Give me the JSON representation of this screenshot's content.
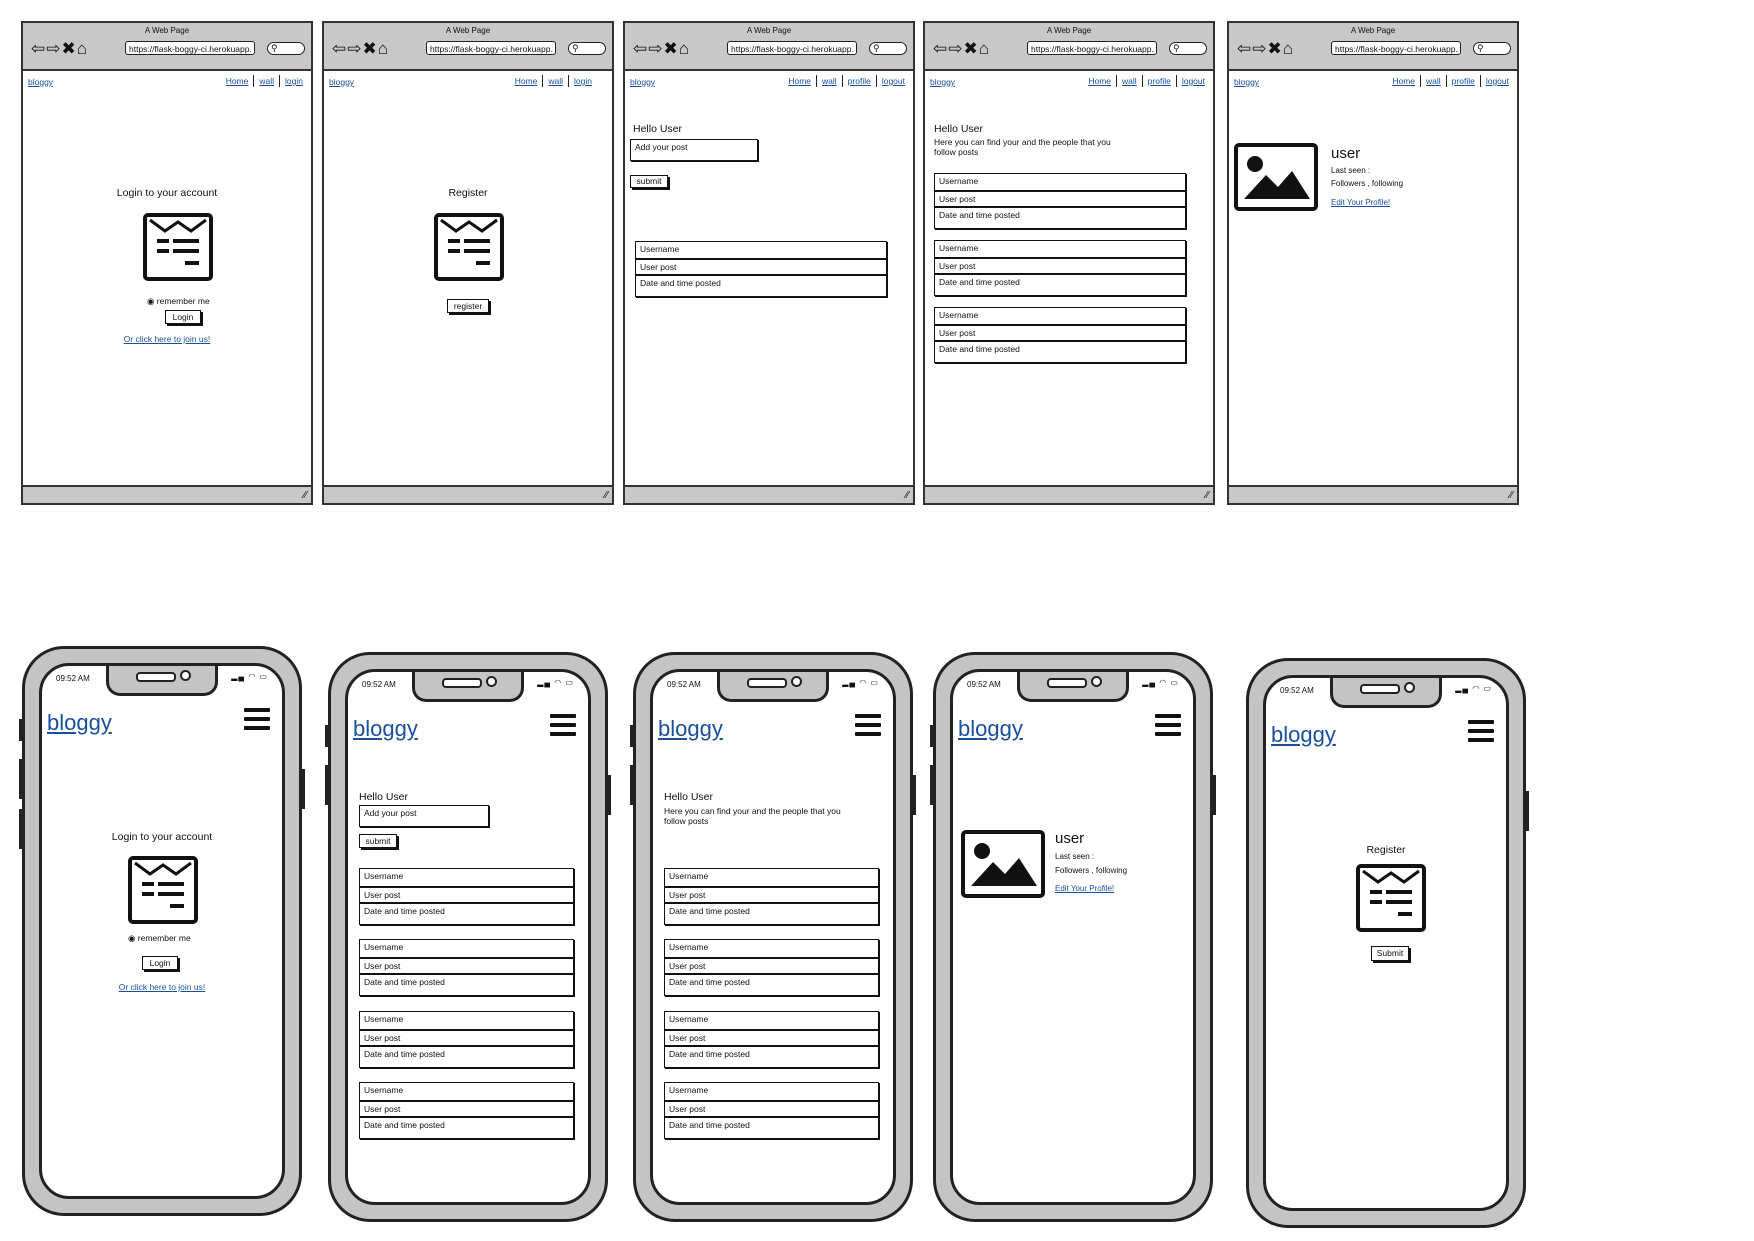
{
  "browser": {
    "window_title": "A Web Page",
    "url": "https://flask-boggy-ci.herokuapp.",
    "brand": "bloggy",
    "nav_home": "Home",
    "nav_wall": "wall",
    "nav_login": "login",
    "nav_profile": "profile",
    "nav_logout": "logout"
  },
  "login": {
    "title": "Login to your account",
    "remember": "remember me",
    "button": "Login",
    "join_link": "Or click here to join us!"
  },
  "register": {
    "title": "Register",
    "button_desktop": "register",
    "button_mobile": "Submit"
  },
  "home": {
    "greeting": "Hello User",
    "post_placeholder": "Add your post",
    "submit": "submit"
  },
  "wall": {
    "greeting": "Hello User",
    "desc_desktop_1": "Here you can find your and the people that you",
    "desc_desktop_2": "follow posts",
    "desc_mobile_1": "Here you can find your and the people that you",
    "desc_mobile_2": "follow posts"
  },
  "post": {
    "username": "Username",
    "body": "User post",
    "date": "Date and time posted"
  },
  "profile": {
    "name": "user",
    "last_seen": "Last seen :",
    "follow": "Followers , following",
    "edit_link": "Edit Your Profile!"
  },
  "phone": {
    "clock": "09:52 AM",
    "brand": "bloggy"
  }
}
